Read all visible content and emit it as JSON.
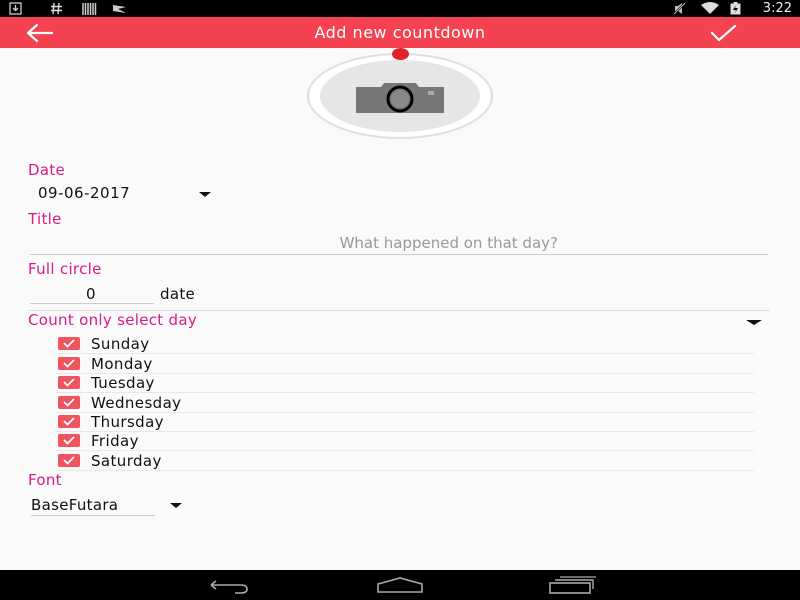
{
  "status_bar": {
    "time": "3:22",
    "left_icons": [
      "download-icon",
      "hashtag-icon",
      "barcode-icon",
      "flag-icon"
    ],
    "right_icons": [
      "mute-icon",
      "wifi-icon",
      "battery-icon"
    ]
  },
  "app_bar": {
    "title": "Add new countdown",
    "back_icon": "arrow-back-icon",
    "confirm_icon": "check-icon",
    "color": "#f44250"
  },
  "photo": {
    "icon": "camera-icon",
    "accent_dot_color": "#e0202a"
  },
  "form": {
    "date": {
      "label": "Date",
      "value": "09-06-2017"
    },
    "title": {
      "label": "Title",
      "placeholder": "What happened on that day?",
      "value": ""
    },
    "full_circle": {
      "label": "Full circle",
      "value": "0",
      "unit": "date"
    },
    "count_days": {
      "label": "Count only select day",
      "days": [
        {
          "label": "Sunday",
          "checked": true
        },
        {
          "label": "Monday",
          "checked": true
        },
        {
          "label": "Tuesday",
          "checked": true
        },
        {
          "label": "Wednesday",
          "checked": true
        },
        {
          "label": "Thursday",
          "checked": true
        },
        {
          "label": "Friday",
          "checked": true
        },
        {
          "label": "Saturday",
          "checked": true
        }
      ]
    },
    "font": {
      "label": "Font",
      "value": "BaseFutara"
    }
  },
  "colors": {
    "accent_label": "#d81b8a",
    "checkbox": "#f0545e"
  },
  "nav_bar": {
    "buttons": [
      "back-nav-icon",
      "home-nav-icon",
      "recents-nav-icon"
    ]
  }
}
